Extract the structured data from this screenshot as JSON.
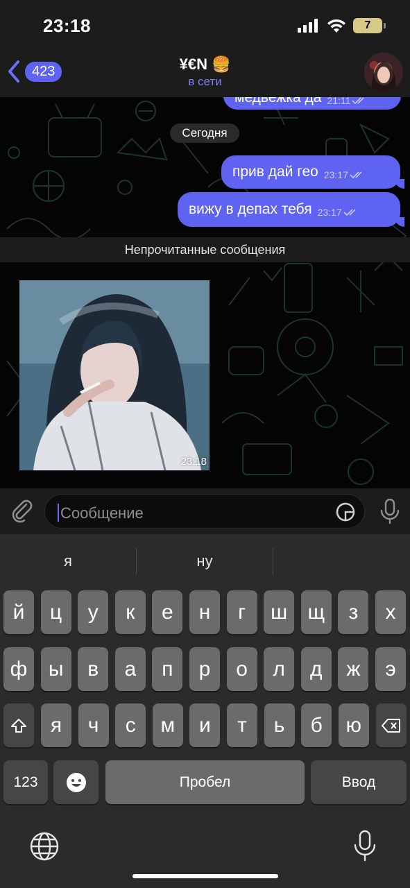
{
  "status_bar": {
    "time": "23:18",
    "battery": "7"
  },
  "header": {
    "back_count": "423",
    "title": "¥€N",
    "title_emoji": "🍔",
    "status": "в сети"
  },
  "chat": {
    "partial_message": {
      "text": "медвежка да",
      "time": "21:11"
    },
    "date_label": "Сегодня",
    "messages": [
      {
        "text": "прив дай гео",
        "time": "23:17"
      },
      {
        "text": "вижу в депах тебя",
        "time": "23:17"
      }
    ],
    "unread_label": "Непрочитанные сообщения",
    "photo_time": "23:18"
  },
  "input": {
    "placeholder": "Сообщение"
  },
  "keyboard": {
    "suggestions": [
      "я",
      "ну"
    ],
    "row1": [
      "й",
      "ц",
      "у",
      "к",
      "е",
      "н",
      "г",
      "ш",
      "щ",
      "з",
      "х"
    ],
    "row2": [
      "ф",
      "ы",
      "в",
      "а",
      "п",
      "р",
      "о",
      "л",
      "д",
      "ж",
      "э"
    ],
    "row3": [
      "я",
      "ч",
      "с",
      "м",
      "и",
      "т",
      "ь",
      "б",
      "ю"
    ],
    "numbers_label": "123",
    "space_label": "Пробел",
    "return_label": "Ввод"
  },
  "colors": {
    "accent": "#5f63f2",
    "bubble_time": "#c9caff",
    "background": "#050505"
  }
}
